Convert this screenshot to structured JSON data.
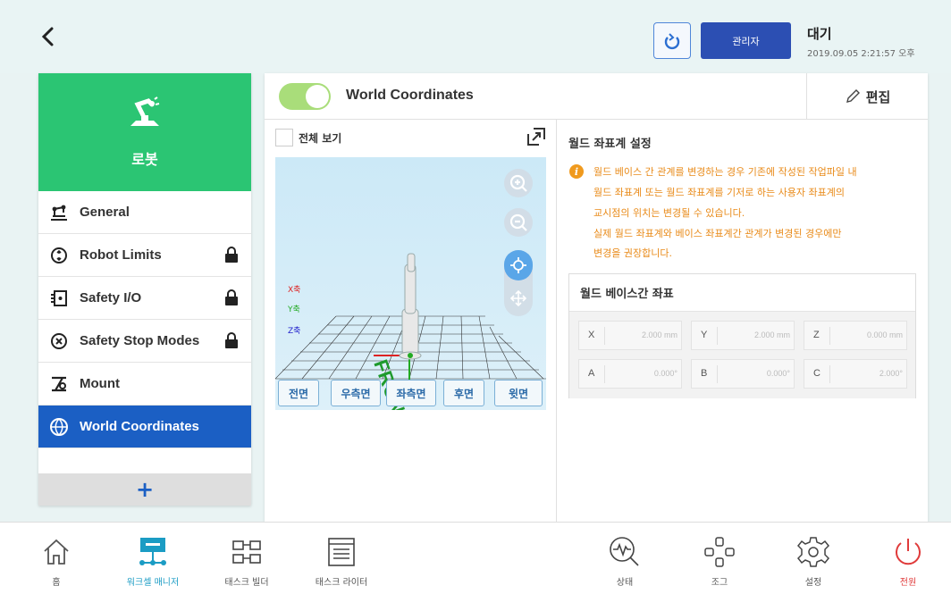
{
  "header": {
    "admin_label": "관리자",
    "status": "대기",
    "datetime": "2019.09.05 2:21:57 오후"
  },
  "sidebar": {
    "robot_title": "로봇",
    "items": [
      {
        "label": "General",
        "locked": false
      },
      {
        "label": "Robot Limits",
        "locked": true
      },
      {
        "label": "Safety I/O",
        "locked": true
      },
      {
        "label": "Safety Stop Modes",
        "locked": true
      },
      {
        "label": "Mount",
        "locked": false
      },
      {
        "label": "World Coordinates",
        "locked": false,
        "active": true
      }
    ],
    "add_label": "+"
  },
  "main": {
    "title": "World Coordinates",
    "toggle_on": true,
    "edit_label": "편집",
    "viewer": {
      "fullview_label": "전체 보기",
      "axis_x": "X축",
      "axis_y": "Y축",
      "axis_z": "Z축",
      "floor_text": "FRONT",
      "view_buttons": [
        "전면",
        "우측면",
        "좌측면",
        "후면",
        "윗면"
      ]
    },
    "settings": {
      "title": "월드 좌표계 설정",
      "warning_lines": [
        "월드 베이스 간 관계를 변경하는 경우 기존에 작성된 작업파일 내",
        "월드 좌표계 또는 월드 좌표계를 기저로 하는 사용자 좌표계의",
        "교시점의 위치는 변경될 수 있습니다.",
        "실제 월드 좌표계와 베이스 좌표계간 관계가 변경된 경우에만",
        "변경을 권장합니다."
      ],
      "coord_title": "월드 베이스간 좌표",
      "fields": [
        {
          "label": "X",
          "value": "2.000 mm"
        },
        {
          "label": "Y",
          "value": "2.000 mm"
        },
        {
          "label": "Z",
          "value": "0.000 mm"
        },
        {
          "label": "A",
          "value": "0.000°"
        },
        {
          "label": "B",
          "value": "0.000°"
        },
        {
          "label": "C",
          "value": "2.000°"
        }
      ]
    }
  },
  "bottom_nav": {
    "home": "홈",
    "workcell": "워크셀 매니저",
    "task_builder": "태스크 빌더",
    "task_writer": "태스크 라이터",
    "status": "상태",
    "jog": "조그",
    "settings": "설정",
    "power": "전원"
  },
  "colors": {
    "accent_blue": "#1b5fc4",
    "robot_green": "#2bc573",
    "toggle_green": "#a9dd7a",
    "warning_orange": "#e98b1a",
    "power_red": "#e03b3b"
  }
}
